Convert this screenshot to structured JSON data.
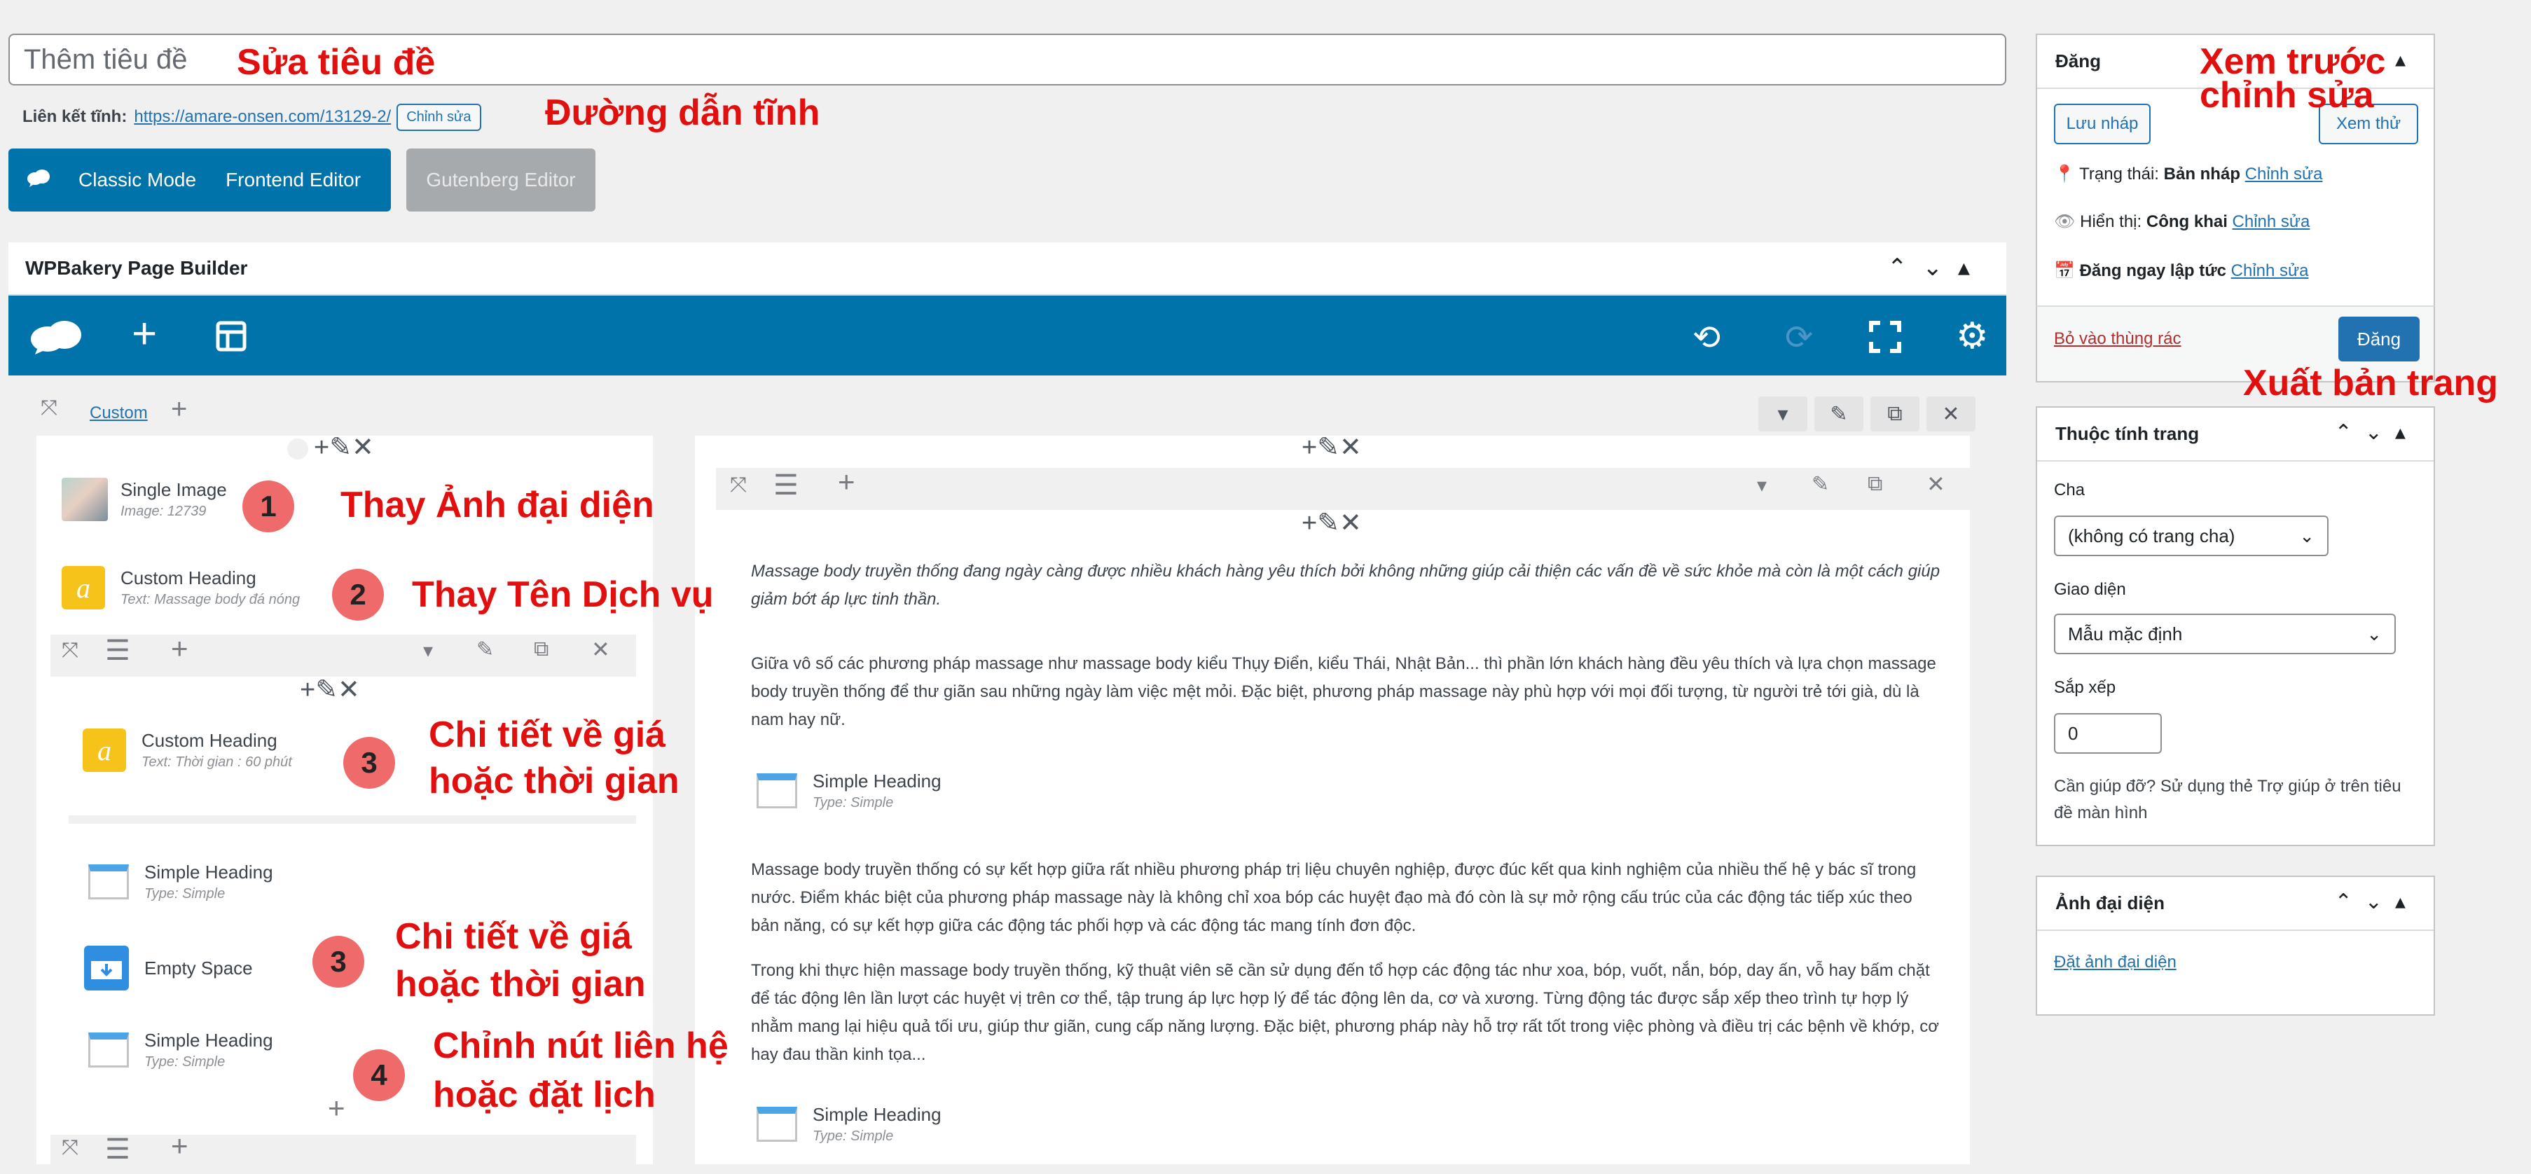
{
  "title": {
    "placeholder": "Thêm tiêu đề"
  },
  "permalink": {
    "label": "Liên kết tĩnh:",
    "url": "https://amare-onsen.com/13129-2/",
    "edit_button": "Chỉnh sửa"
  },
  "modes": {
    "classic": "Classic Mode",
    "frontend": "Frontend Editor",
    "gutenberg": "Gutenberg Editor"
  },
  "wpbakery": {
    "title": "WPBakery Page Builder",
    "left_column": {
      "tab_label": "Custom",
      "elements": [
        {
          "name": "Single Image",
          "sub": "Image: 12739"
        },
        {
          "name": "Custom Heading",
          "sub": "Text: Massage body đá nóng"
        },
        {
          "name": "Custom Heading",
          "sub": "Text: Thời gian : 60 phút"
        },
        {
          "name": "Simple Heading",
          "sub": "Type: Simple"
        },
        {
          "name": "Empty Space",
          "sub": ""
        },
        {
          "name": "Simple Heading",
          "sub": "Type: Simple"
        }
      ]
    },
    "right_column": {
      "paragraph1": "Massage body truyền thống đang ngày càng được nhiều khách hàng yêu thích bởi không những giúp cải thiện các vấn đề về sức khỏe mà còn là một cách giúp giảm bớt áp lực tinh thần.",
      "paragraph2": "Giữa vô số các phương pháp massage như massage body kiểu Thụy Điển, kiểu Thái, Nhật Bản... thì phần lớn khách hàng đều yêu thích và lựa chọn massage body truyền thống để thư giãn sau những ngày làm việc mệt mỏi. Đặc biệt, phương pháp massage này phù hợp với mọi đối tượng, từ người trẻ tới già, dù là nam hay nữ.",
      "heading1": {
        "name": "Simple Heading",
        "sub": "Type: Simple"
      },
      "paragraph3": "Massage body truyền thống có sự kết hợp giữa rất nhiều phương pháp trị liệu chuyên nghiệp, được đúc kết qua kinh nghiệm của nhiều thế hệ y bác sĩ trong nước. Điểm khác biệt của phương pháp massage này là không chỉ xoa bóp các huyệt đạo mà đó còn là sự mở rộng cấu trúc của các động tác tiếp xúc theo bản năng, có sự kết hợp giữa các động tác phối hợp và các động tác mang tính đơn độc.",
      "paragraph4": "Trong khi thực hiện massage body truyền thống, kỹ thuật viên sẽ cần sử dụng đến tổ hợp các động tác như xoa, bóp, vuốt, nắn, bóp, day ấn, vỗ hay bấm chặt để tác động lên lần lượt các huyệt vị trên cơ thể, tập trung áp lực hợp lý để tác động lên da, cơ và xương. Từng động tác được sắp xếp theo trình tự hợp lý nhằm mang lại hiệu quả tối ưu, giúp thư giãn, cung cấp năng lượng. Đặc biệt, phương pháp này hỗ trợ rất tốt trong việc phòng và điều trị các bệnh về khớp, cơ hay đau thần kinh tọa...",
      "heading2": {
        "name": "Simple Heading",
        "sub": "Type: Simple"
      }
    }
  },
  "annotations": {
    "edit_title": "Sửa tiêu đề",
    "permalink": "Đường dẫn tĩnh",
    "preview_line1": "Xem trước",
    "preview_line2": "chỉnh sửa",
    "publish_page": "Xuất bản trang",
    "note1": "Thay Ảnh đại diện",
    "note2": "Thay Tên Dịch vụ",
    "note3a_line1": "Chi tiết về giá",
    "note3a_line2": "hoặc thời gian",
    "note3b_line1": "Chi tiết về giá",
    "note3b_line2": "hoặc thời gian",
    "note4_line1": "Chỉnh nút liên hệ",
    "note4_line2": "hoặc đặt lịch",
    "badge1": "1",
    "badge2": "2",
    "badge3a": "3",
    "badge3b": "3",
    "badge4": "4"
  },
  "publish_box": {
    "title": "Đăng",
    "save_draft": "Lưu nháp",
    "preview": "Xem thử",
    "status_label": "Trạng thái:",
    "status_value": "Bản nháp",
    "visibility_label": "Hiển thị:",
    "visibility_value": "Công khai",
    "publish_label": "Đăng ngay lập tức",
    "edit_link": "Chỉnh sửa",
    "trash": "Bỏ vào thùng rác",
    "publish_button": "Đăng"
  },
  "page_attributes": {
    "title": "Thuộc tính trang",
    "parent_label": "Cha",
    "parent_value": "(không có trang cha)",
    "template_label": "Giao diện",
    "template_value": "Mẫu mặc định",
    "order_label": "Sắp xếp",
    "order_value": "0",
    "help_text": "Cần giúp đỡ? Sử dụng thẻ Trợ giúp ở trên tiêu đề màn hình"
  },
  "featured_image": {
    "title": "Ảnh đại diện",
    "set_link": "Đặt ảnh đại diện"
  },
  "colors": {
    "accent": "#0073aa",
    "annotation_red": "#e1100f",
    "badge_red": "#ef6b6b",
    "heading_blue": "#4aa4e6",
    "custom_heading_yellow": "#f6c31a"
  }
}
